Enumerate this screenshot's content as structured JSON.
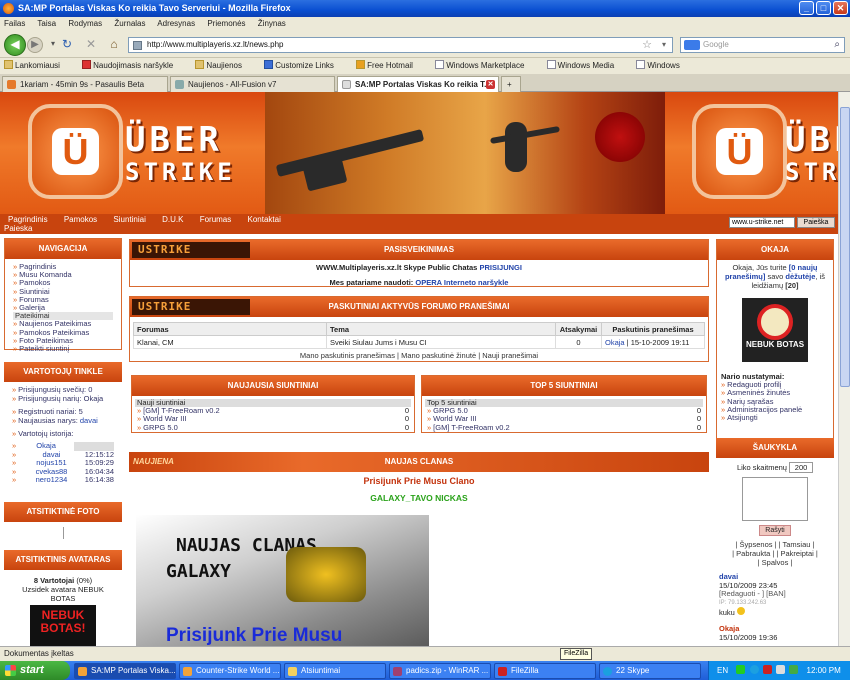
{
  "window": {
    "title": "SA:MP Portalas Viskas Ko reikia Tavo Serveriui - Mozilla Firefox"
  },
  "menu": [
    "Failas",
    "Taisa",
    "Rodymas",
    "Žurnalas",
    "Adresynas",
    "Priemonės",
    "Žinynas"
  ],
  "address": {
    "url": "http://www.multiplayeris.xz.lt/news.php",
    "search_placeholder": "Google"
  },
  "bookmarks": [
    "Lankomiausi",
    "Naudojimasis naršykle",
    "Naujienos",
    "Customize Links",
    "Free Hotmail",
    "Windows Marketplace",
    "Windows Media",
    "Windows"
  ],
  "tabs": [
    "1kariam - 45min 9s - Pasaulis Beta",
    "Naujienos - All-Fusion v7",
    "SA:MP Portalas Viskas Ko reikia T..."
  ],
  "banner": {
    "brand_line1": "ÜBER",
    "brand_line2": "STRIKE",
    "logo_letter": "Ü"
  },
  "topnav": {
    "links": [
      "Pagrindinis",
      "Pamokos",
      "Siuntiniai",
      "D.U.K",
      "Forumas",
      "Kontaktai"
    ],
    "search_label": "Paieska",
    "search_value": "www.u-strike.net",
    "search_button": "Paieška"
  },
  "left": {
    "nav": {
      "title": "NAVIGACIJA",
      "items": [
        "Pagrindinis",
        "Musu Komanda",
        "Pamokos",
        "Siuntiniai",
        "Forumas",
        "Galerija"
      ],
      "section": "Pateikimai",
      "sub_items": [
        "Naujienos Pateikimas",
        "Pamokos Pateikimas",
        "Foto Pateikimas",
        "Pateikti siuntinį"
      ]
    },
    "users": {
      "title": "VARTOTOJŲ TINKLE",
      "guests": "Prisijungusių svečių: 0",
      "members": "Prisijungusių narių: Okaja",
      "registered": "Registruoti nariai: 5",
      "newest_label": "Naujausias narys:",
      "newest_name": "davai",
      "history_label": "Vartotojų istorija:",
      "history": [
        {
          "name": "Okaja",
          "time": ""
        },
        {
          "name": "davai",
          "time": "12:15:12"
        },
        {
          "name": "nojus151",
          "time": "15:09:29"
        },
        {
          "name": "cvekas88",
          "time": "16:04:34"
        },
        {
          "name": "nero1234",
          "time": "16:14:38"
        }
      ]
    },
    "photo": {
      "title": "ATSITIKTINĖ FOTO"
    },
    "avatar": {
      "title": "ATSITIKTINIS AVATARAS",
      "count_label": "8 Vartotojai",
      "count_pct": "(0%)",
      "desc": "Uzsidek avatara NEBUK BOTAS",
      "img_text": "NEBUK BOTAS!"
    }
  },
  "center": {
    "welcome": {
      "logo": "USTRIKE",
      "title": "PASISVEIKINIMAS",
      "line1": "WWW.Multiplayeris.xz.lt Skype Public Chatas",
      "line1_link": "PRISIJUNGI",
      "line2": "Mes patariame naudoti:",
      "line2_link": "OPERA Interneto naršykle"
    },
    "forum": {
      "logo": "USTRIKE",
      "title": "PASKUTINIAI AKTYVŪS FORUMO PRANEŠIMAI",
      "headers": [
        "Forumas",
        "Tema",
        "Atsakymai",
        "Paskutinis pranešimas"
      ],
      "rows": [
        {
          "forum": "Klanai, CM",
          "topic": "Sveiki Siulau Jums i Musu CI",
          "replies": "0",
          "user": "Okaja",
          "date": "15-10-2009 19:11"
        }
      ],
      "footer": "Mano paskutinis pranešimas | Mano paskutinė žinutė | Nauji pranešimai"
    },
    "newest": {
      "title": "NAUJAUSIA SIUNTINIAI",
      "sub": "Nauji siuntiniai",
      "items": [
        {
          "name": "[GM] T-FreeRoam v0.2",
          "n": "0"
        },
        {
          "name": "World War III",
          "n": "0"
        },
        {
          "name": "GRPG 5.0",
          "n": "0"
        }
      ]
    },
    "top": {
      "title": "TOP 5 SIUNTINIAI",
      "sub": "Top 5 siuntiniai",
      "items": [
        {
          "name": "GRPG 5.0",
          "n": "0"
        },
        {
          "name": "World War III",
          "n": "0"
        },
        {
          "name": "[GM] T-FreeRoam v0.2",
          "n": "0"
        }
      ]
    },
    "news": {
      "badge": "NAUJIENA",
      "title": "NAUJAS CLANAS",
      "line1": "Prisijunk Prie Musu Clano",
      "line2": "GALAXY_TAVO NICKAS",
      "img_line1": "NAUJAS CLANAS",
      "img_line2": "GALAXY",
      "img_line3": "Prisijunk Prie Musu"
    }
  },
  "right": {
    "okaja": {
      "title": "OKAJA",
      "greet_pre": "Okaja, Jūs turite",
      "new_msgs": "[0 naujų pranešimų]",
      "greet_mid": "savo",
      "inbox": "dėžutėje",
      "greet_post": ", iš leidžiamų",
      "limit": "[20]",
      "avatar_text": "NEBUK BOTAS",
      "settings_title": "Nario nustatymai:",
      "settings": [
        "Redaguoti profilį",
        "Asmeninės žinutės",
        "Narių sąrašas",
        "Administracijos panelė",
        "Atsijungti"
      ]
    },
    "shout": {
      "title": "ŠAUKYKLA",
      "left_label": "Liko skaitmenų",
      "left_value": "200",
      "button": "Rašyti",
      "links_l1": "| Šypsenos | | Tamsiau |",
      "links_l2": "| Pabraukta | | Pakreiptai |",
      "links_l3": "| Spalvos |",
      "posts": [
        {
          "user": "davai",
          "date": "15/10/2009 23:45",
          "meta": "[Redaguoti - ] [BAN]",
          "ip": "IP: 79.133.242.63",
          "text": "kuku"
        },
        {
          "user": "Okaja",
          "date": "15/10/2009 19:36",
          "meta": "",
          "ip": "",
          "text": ""
        }
      ]
    }
  },
  "status": {
    "text": "Dokumentas įkeltas",
    "tooltip": "FileZilla"
  },
  "taskbar": {
    "start": "start",
    "tasks": [
      "SA:MP Portalas Viska...",
      "Counter-Strike World ...",
      "Atsiuntimai",
      "padics.zip - WinRAR ...",
      "FileZilla",
      "22 Skype"
    ],
    "lang": "EN",
    "clock": "12:00 PM"
  }
}
